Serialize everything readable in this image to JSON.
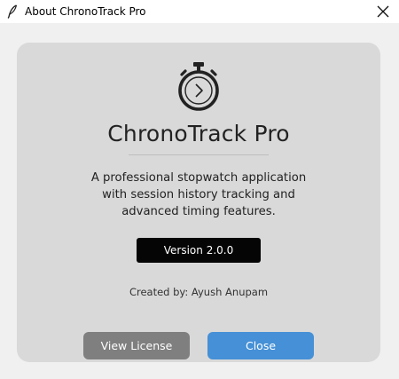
{
  "window": {
    "title": "About ChronoTrack Pro",
    "title_icon": "feather-icon",
    "close_icon": "close-icon"
  },
  "about": {
    "logo_icon": "stopwatch-icon",
    "app_name": "ChronoTrack Pro",
    "description_lines": [
      "A professional stopwatch application",
      "with session history tracking and",
      "advanced timing features."
    ],
    "version": "Version 2.0.0",
    "credits": "Created by: Ayush Anupam"
  },
  "buttons": {
    "license_label": "View License",
    "close_label": "Close"
  },
  "colors": {
    "card_background": "#d9d9d9",
    "version_badge": "#050505",
    "license_button": "#7f7f7f",
    "close_button": "#4590d6"
  }
}
